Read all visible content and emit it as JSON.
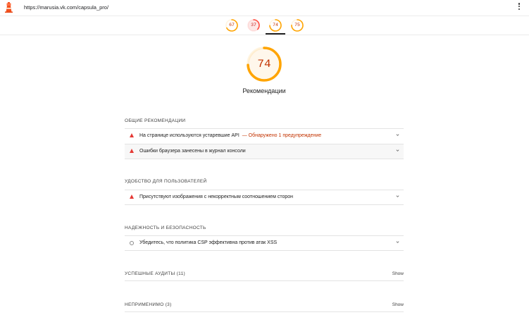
{
  "header": {
    "url": "https://marusia.vk.com/capsula_pro/"
  },
  "tabs": [
    {
      "score": "67",
      "color": "#ffa400",
      "fill": 0.67
    },
    {
      "score": "37",
      "color": "#ff4e42",
      "fill": 0.37
    },
    {
      "score": "74",
      "color": "#ffa400",
      "fill": 0.74,
      "active": true
    },
    {
      "score": "75",
      "color": "#ffa400",
      "fill": 0.75
    }
  ],
  "gauge": {
    "score": "74",
    "fill": 0.74,
    "color": "#ffa400",
    "label": "Рекомендации"
  },
  "colors": {
    "fail": "#e53935",
    "warn_text": "#c33300",
    "average": "#ffa400"
  },
  "sections": [
    {
      "title": "ОБЩИЕ РЕКОМЕНДАЦИИ",
      "audits": [
        {
          "text": "На странице используются устаревшие API",
          "warning": "— Обнаружено 1 предупреждение",
          "icon": "fail-triangle-icon"
        },
        {
          "text": "Ошибки браузера занесены в журнал консоли",
          "warning": "",
          "icon": "fail-triangle-icon"
        }
      ]
    },
    {
      "title": "УДОБСТВО ДЛЯ ПОЛЬЗОВАТЕЛЕЙ",
      "audits": [
        {
          "text": "Присутствуют изображения с некорректным соотношением сторон",
          "warning": "",
          "icon": "fail-triangle-icon"
        }
      ]
    },
    {
      "title": "НАДЕЖНОСТЬ И БЕЗОПАСНОСТЬ",
      "audits": [
        {
          "text": "Убедитесь, что политика CSP эффективна против атак XSS",
          "warning": "",
          "icon": "manual-circle-icon"
        }
      ]
    }
  ],
  "groups": [
    {
      "label": "УСПЕШНЫЕ АУДИТЫ",
      "count": "(11)",
      "show": "Show"
    },
    {
      "label": "НЕПРИМЕНИМО",
      "count": "(3)",
      "show": "Show"
    }
  ]
}
